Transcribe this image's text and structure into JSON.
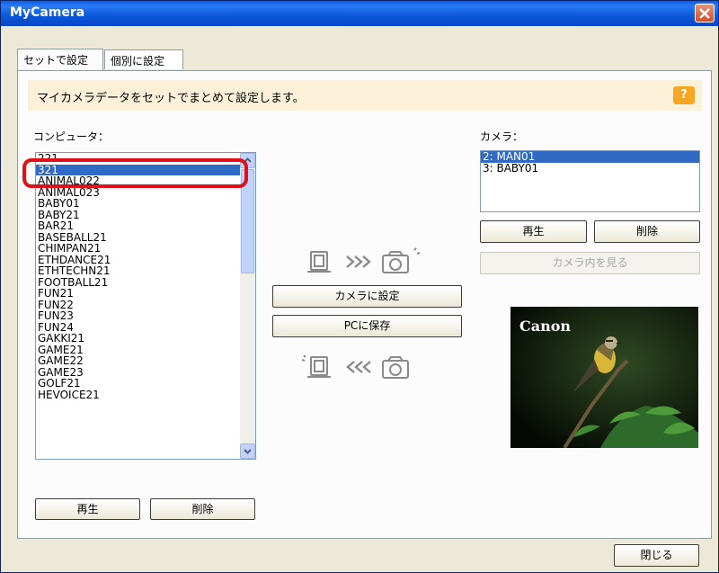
{
  "window": {
    "title": "MyCamera"
  },
  "tabs": [
    {
      "label": "セットで設定"
    },
    {
      "label": "個別に設定"
    }
  ],
  "info": {
    "text": "マイカメラデータをセットでまとめて設定します。",
    "help": "?"
  },
  "computer": {
    "label": "コンピュータ：",
    "items": [
      "221",
      "321",
      "ANIMAL022",
      "ANIMAL023",
      "BABY01",
      "BABY21",
      "BAR21",
      "BASEBALL21",
      "CHIMPAN21",
      "ETHDANCE21",
      "ETHTECHN21",
      "FOOTBALL21",
      "FUN21",
      "FUN22",
      "FUN23",
      "FUN24",
      "GAKKI21",
      "GAME21",
      "GAME22",
      "GAME23",
      "GOLF21",
      "HEVOICE21"
    ],
    "selected": "321",
    "play": "再生",
    "delete": "削除"
  },
  "camera": {
    "label": "カメラ：",
    "items": [
      "2: MAN01",
      "3: BABY01"
    ],
    "selected": "2: MAN01",
    "play": "再生",
    "delete": "削除",
    "view": "カメラ内を見る",
    "photo_brand": "Canon"
  },
  "transfer": {
    "to_camera": "カメラに設定",
    "to_pc": "PCに保存"
  },
  "footer": {
    "close": "閉じる"
  },
  "icons": {
    "pc": "computer-icon",
    "camera": "camera-icon"
  }
}
